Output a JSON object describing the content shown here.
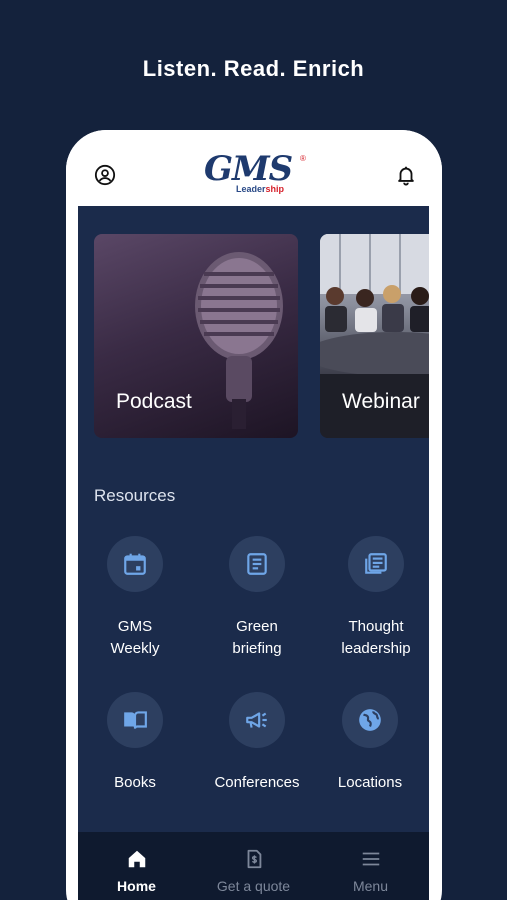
{
  "headline": "Listen. Read. Enrich",
  "header": {
    "logo_main": "GMS",
    "logo_sub_prefix": "Leader",
    "logo_sub_accent": "ship",
    "logo_reg": "®"
  },
  "featured": [
    {
      "label": "Podcast"
    },
    {
      "label": "Webinar"
    }
  ],
  "resources": {
    "title": "Resources",
    "items": [
      {
        "line1": "GMS",
        "line2": "Weekly",
        "icon": "calendar-icon"
      },
      {
        "line1": "Green",
        "line2": "briefing",
        "icon": "document-icon"
      },
      {
        "line1": "Thought",
        "line2": "leadership",
        "icon": "newspaper-icon"
      },
      {
        "line1": "Books",
        "line2": "",
        "icon": "book-icon"
      },
      {
        "line1": "Conferences",
        "line2": "",
        "icon": "megaphone-icon"
      },
      {
        "line1": "Locations",
        "line2": "",
        "icon": "globe-icon"
      }
    ]
  },
  "nav": {
    "items": [
      {
        "label": "Home",
        "icon": "home-icon",
        "active": true
      },
      {
        "label": "Get a quote",
        "icon": "quote-document-icon",
        "active": false
      },
      {
        "label": "Menu",
        "icon": "hamburger-menu-icon",
        "active": false
      }
    ]
  },
  "colors": {
    "background": "#14223c",
    "content": "#1b2b4b",
    "circle": "#2d3f60",
    "navbar": "#0f1a2f",
    "logo_blue": "#1e3a6e",
    "logo_red": "#d6202a"
  }
}
